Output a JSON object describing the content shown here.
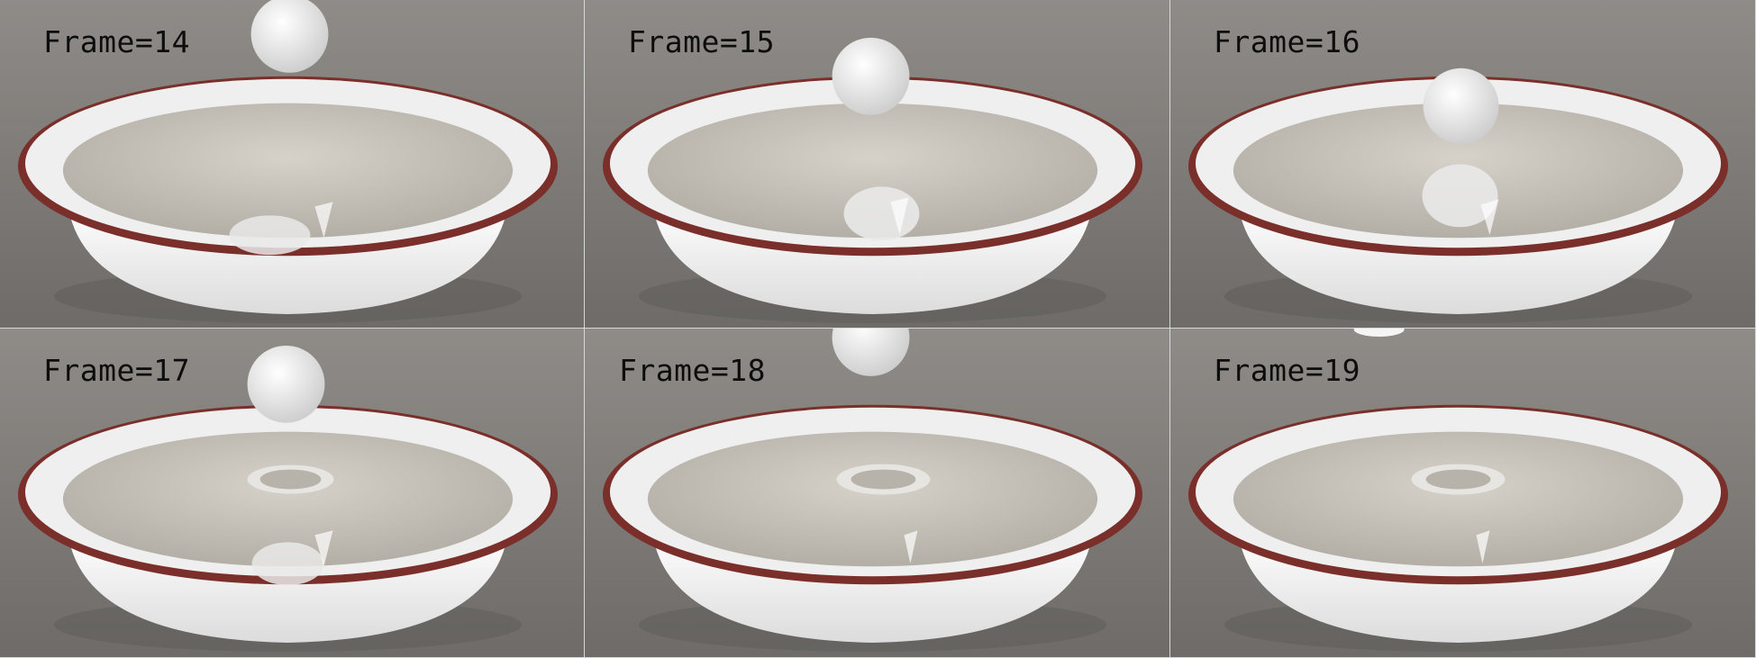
{
  "panels": [
    {
      "label": "Frame=14",
      "ball": "above-rim",
      "splash": false,
      "reflection": "visible"
    },
    {
      "label": "Frame=15",
      "ball": "falling",
      "splash": false,
      "reflection": "visible"
    },
    {
      "label": "Frame=16",
      "ball": "near-surface",
      "splash": false,
      "reflection": "close"
    },
    {
      "label": "Frame=17",
      "ball": "above-rim",
      "splash": true,
      "reflection": "visible"
    },
    {
      "label": "Frame=18",
      "ball": "top-edge",
      "splash": true,
      "reflection": "faint"
    },
    {
      "label": "Frame=19",
      "ball": "off-top",
      "splash": true,
      "reflection": "none"
    }
  ],
  "colors": {
    "floor": "#8d8a86",
    "floor_dark": "#6f6c69",
    "bowl_rim": "#7a2f2a",
    "bowl_body": "#f2f2f2",
    "liquid": "#c9c5bd",
    "ball": "#f5f5f5",
    "label_text": "#0d0d0d"
  }
}
